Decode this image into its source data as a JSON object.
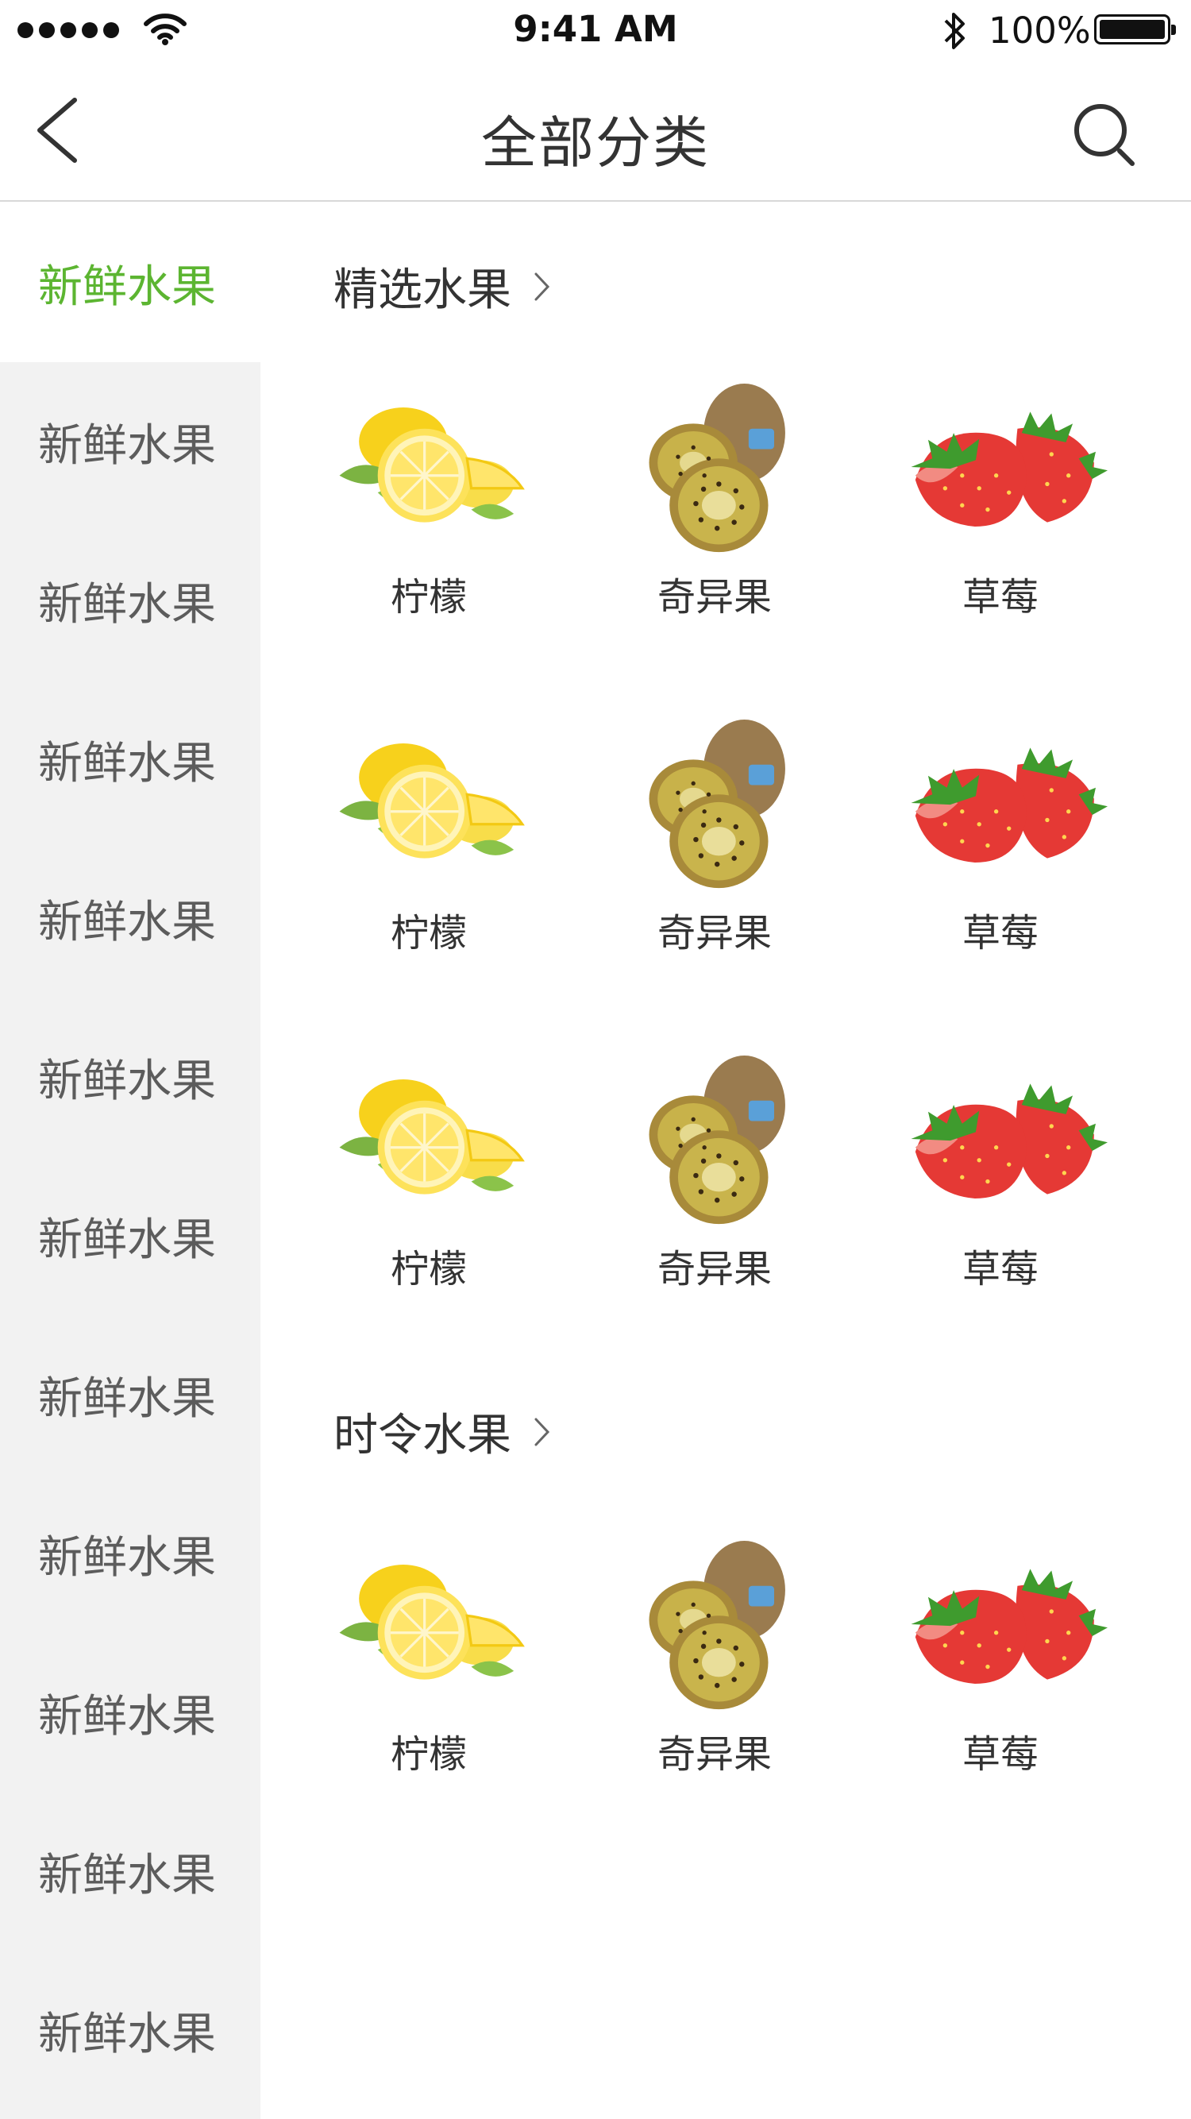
{
  "status_bar": {
    "time": "9:41 AM",
    "battery": "100%"
  },
  "nav": {
    "title": "全部分类"
  },
  "sidebar": {
    "items": [
      {
        "label": "新鲜水果",
        "active": true
      },
      {
        "label": "新鲜水果"
      },
      {
        "label": "新鲜水果"
      },
      {
        "label": "新鲜水果"
      },
      {
        "label": "新鲜水果"
      },
      {
        "label": "新鲜水果"
      },
      {
        "label": "新鲜水果"
      },
      {
        "label": "新鲜水果"
      },
      {
        "label": "新鲜水果"
      },
      {
        "label": "新鲜水果"
      },
      {
        "label": "新鲜水果"
      },
      {
        "label": "新鲜水果"
      }
    ]
  },
  "sections": [
    {
      "title": "精选水果",
      "products": [
        {
          "name": "柠檬",
          "icon": "lemon"
        },
        {
          "name": "奇异果",
          "icon": "kiwi"
        },
        {
          "name": "草莓",
          "icon": "strawberry"
        },
        {
          "name": "柠檬",
          "icon": "lemon"
        },
        {
          "name": "奇异果",
          "icon": "kiwi"
        },
        {
          "name": "草莓",
          "icon": "strawberry"
        },
        {
          "name": "柠檬",
          "icon": "lemon"
        },
        {
          "name": "奇异果",
          "icon": "kiwi"
        },
        {
          "name": "草莓",
          "icon": "strawberry"
        }
      ]
    },
    {
      "title": "时令水果",
      "products": [
        {
          "name": "柠檬",
          "icon": "lemon"
        },
        {
          "name": "奇异果",
          "icon": "kiwi"
        },
        {
          "name": "草莓",
          "icon": "strawberry"
        }
      ]
    }
  ],
  "colors": {
    "accent": "#5cb531",
    "sidebar_bg": "#f2f2f2",
    "text": "#333333"
  }
}
